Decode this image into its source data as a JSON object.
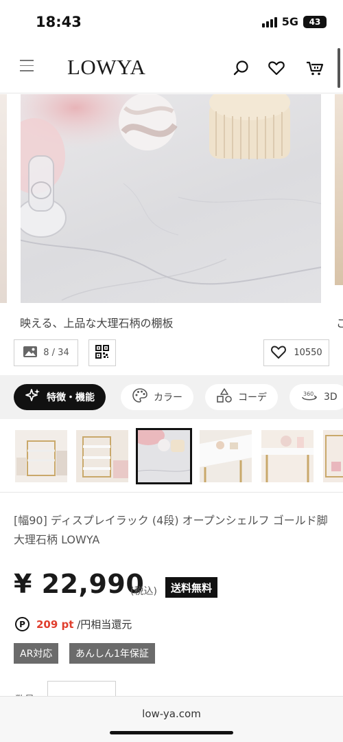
{
  "status_bar": {
    "time": "18:43",
    "network": "5G",
    "battery": "43"
  },
  "header": {
    "logo": "LOWYA",
    "icons": [
      "menu-icon",
      "search-icon",
      "heart-icon",
      "cart-icon"
    ]
  },
  "gallery": {
    "caption": "映える、上品な大理石柄の棚板",
    "caption_peek": "こ",
    "counter": "8 / 34",
    "favorites": "10550"
  },
  "feature_tabs": [
    {
      "label": "特徴・機能",
      "icon": "sparkle-icon",
      "active": true
    },
    {
      "label": "カラー",
      "icon": "palette-icon",
      "active": false
    },
    {
      "label": "コーデ",
      "icon": "shapes-icon",
      "active": false
    },
    {
      "label": "3D",
      "icon": "view-360-icon",
      "active": false
    }
  ],
  "thumbnails": {
    "count": 7,
    "selected_index": 2
  },
  "product": {
    "title": "[幅90] ディスプレイラック (4段) オープンシェルフ ゴールド脚 大理石柄 LOWYA",
    "price": "¥ 22,990",
    "tax_note": "(税込)",
    "shipping_badge": "送料無料",
    "points_icon": "P",
    "points_value": "209 pt",
    "points_suffix": "/円相当還元",
    "badges": [
      "AR対応",
      "あんしん1年保証"
    ],
    "quantity_label": "数量"
  },
  "browser": {
    "url": "low-ya.com"
  }
}
